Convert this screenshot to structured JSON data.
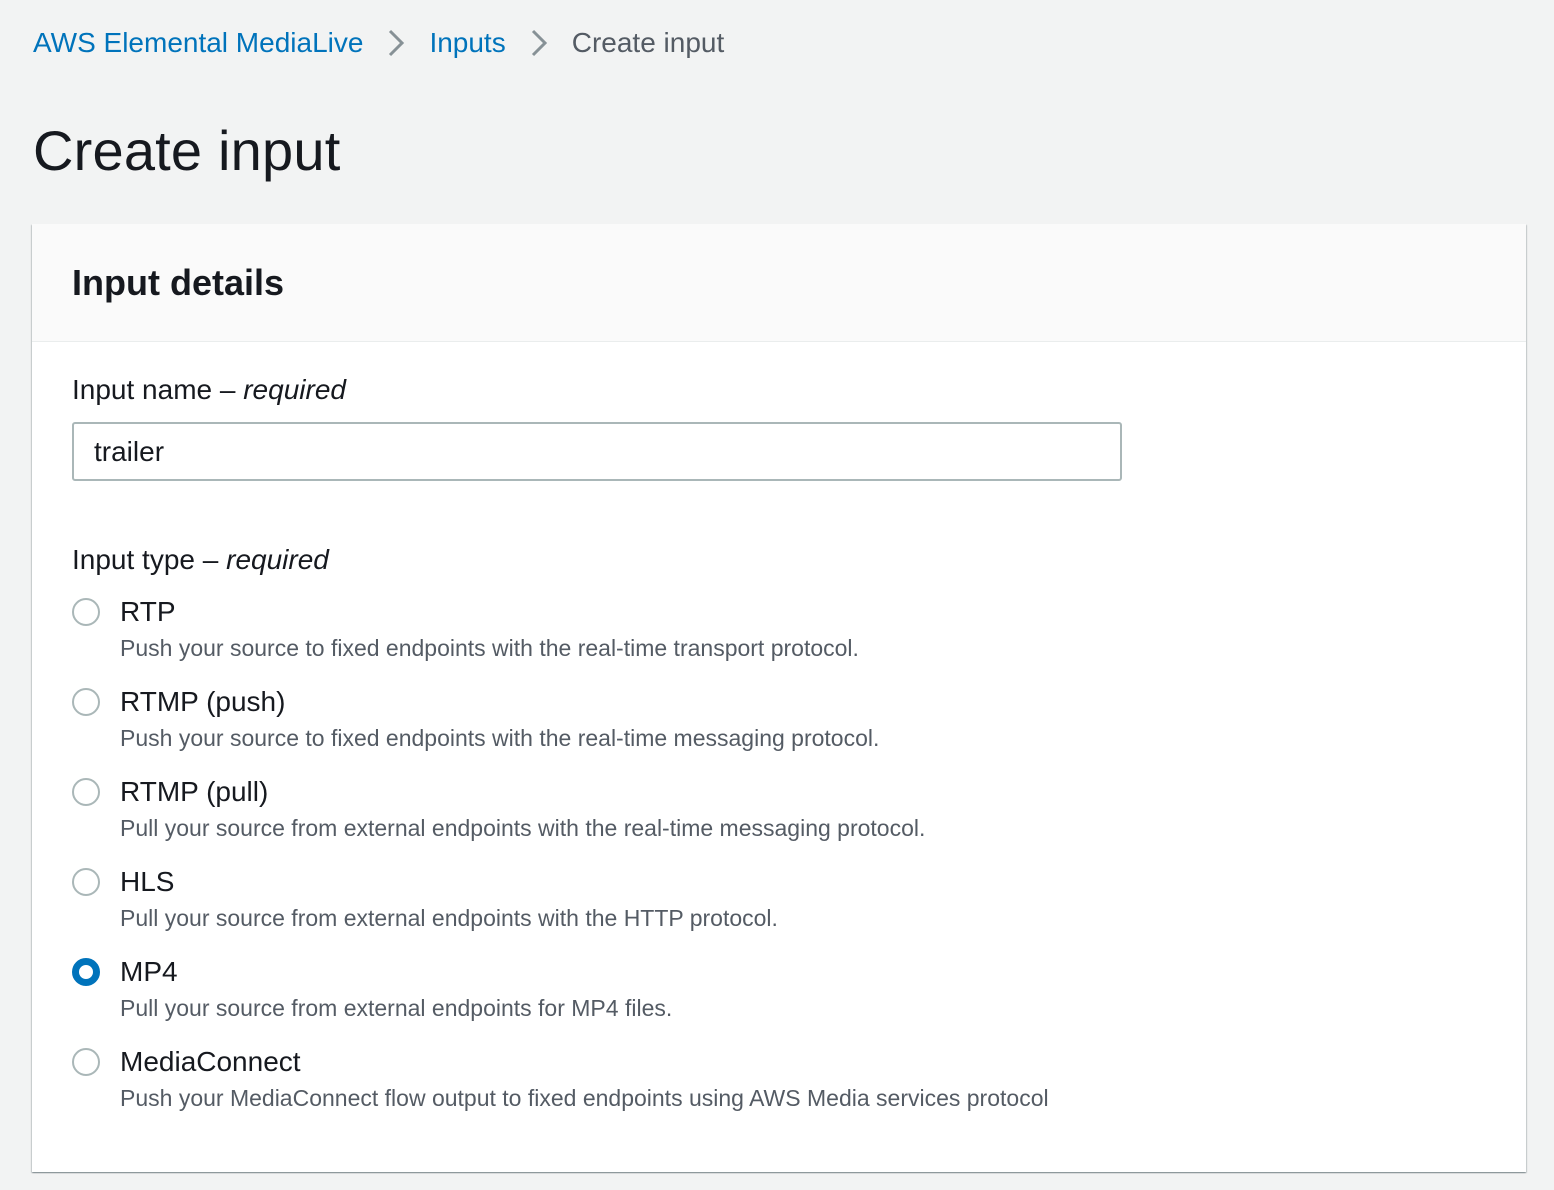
{
  "breadcrumb": {
    "items": [
      {
        "label": "AWS Elemental MediaLive"
      },
      {
        "label": "Inputs"
      },
      {
        "label": "Create input"
      }
    ]
  },
  "page": {
    "title": "Create input"
  },
  "panel": {
    "title": "Input details",
    "input_name": {
      "label": "Input name –",
      "required": "required",
      "value": "trailer"
    },
    "input_type": {
      "label": "Input type –",
      "required": "required",
      "selected": "MP4",
      "options": [
        {
          "title": "RTP",
          "description": "Push your source to fixed endpoints with the real-time transport protocol."
        },
        {
          "title": "RTMP (push)",
          "description": "Push your source to fixed endpoints with the real-time messaging protocol."
        },
        {
          "title": "RTMP (pull)",
          "description": "Pull your source from external endpoints with the real-time messaging protocol."
        },
        {
          "title": "HLS",
          "description": "Pull your source from external endpoints with the HTTP protocol."
        },
        {
          "title": "MP4",
          "description": "Pull your source from external endpoints for MP4 files."
        },
        {
          "title": "MediaConnect",
          "description": "Push your MediaConnect flow output to fixed endpoints using AWS Media services protocol"
        }
      ]
    }
  },
  "colors": {
    "link": "#0073bb",
    "selected_radio": "#0073bb",
    "background": "#f2f3f3"
  }
}
